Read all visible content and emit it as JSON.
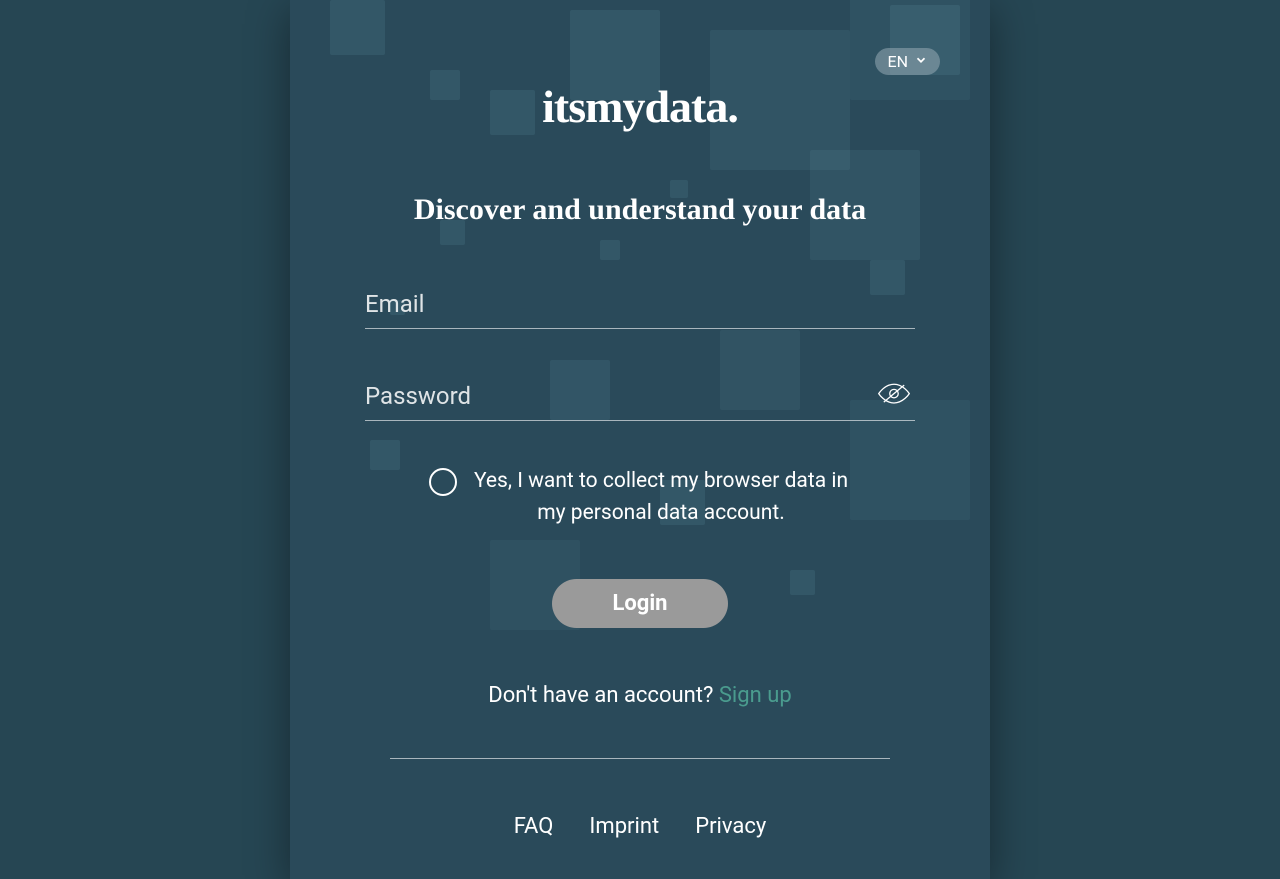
{
  "lang": {
    "current": "EN"
  },
  "brand": {
    "logo": "itsmydata."
  },
  "tagline": "Discover and understand your data",
  "form": {
    "email_placeholder": "Email",
    "password_placeholder": "Password",
    "checkbox_label": "Yes, I want to collect my browser data in my personal data account.",
    "login_button": "Login"
  },
  "signup": {
    "prompt": "Don't have an account? ",
    "link": "Sign up"
  },
  "footer": {
    "faq": "FAQ",
    "imprint": "Imprint",
    "privacy": "Privacy"
  }
}
